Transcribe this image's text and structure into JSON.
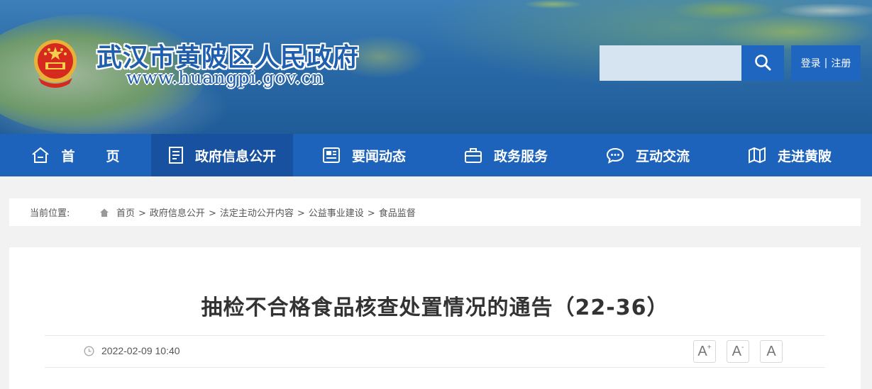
{
  "header": {
    "site_title": "武汉市黄陂区人民政府",
    "site_url": "www.huangpi.gov.cn",
    "search": {
      "placeholder": "",
      "value": ""
    },
    "auth": {
      "login": "登录",
      "separator": "|",
      "register": "注册"
    }
  },
  "nav": {
    "items": [
      {
        "label": "首页",
        "icon": "home-icon"
      },
      {
        "label": "政府信息公开",
        "icon": "document-list-icon",
        "active": true
      },
      {
        "label": "要闻动态",
        "icon": "newspaper-icon"
      },
      {
        "label": "政务服务",
        "icon": "briefcase-icon"
      },
      {
        "label": "互动交流",
        "icon": "chat-bubble-icon"
      },
      {
        "label": "走进黄陂",
        "icon": "map-icon"
      }
    ]
  },
  "breadcrumb": {
    "label": "当前位置:",
    "items": [
      "首页",
      "政府信息公开",
      "法定主动公开内容",
      "公益事业建设",
      "食品监督"
    ],
    "separator": ">"
  },
  "article": {
    "title": "抽检不合格食品核查处置情况的通告（22-36）",
    "datetime": "2022-02-09 10:40",
    "font_controls": {
      "larger": "A",
      "larger_sup": "+",
      "smaller": "A",
      "smaller_sup": "-",
      "default": "A"
    }
  },
  "colors": {
    "nav_bg": "#1d63bb",
    "nav_active": "#1851a0",
    "brand_blue": "#1f66c0",
    "title_text": "#333333"
  }
}
